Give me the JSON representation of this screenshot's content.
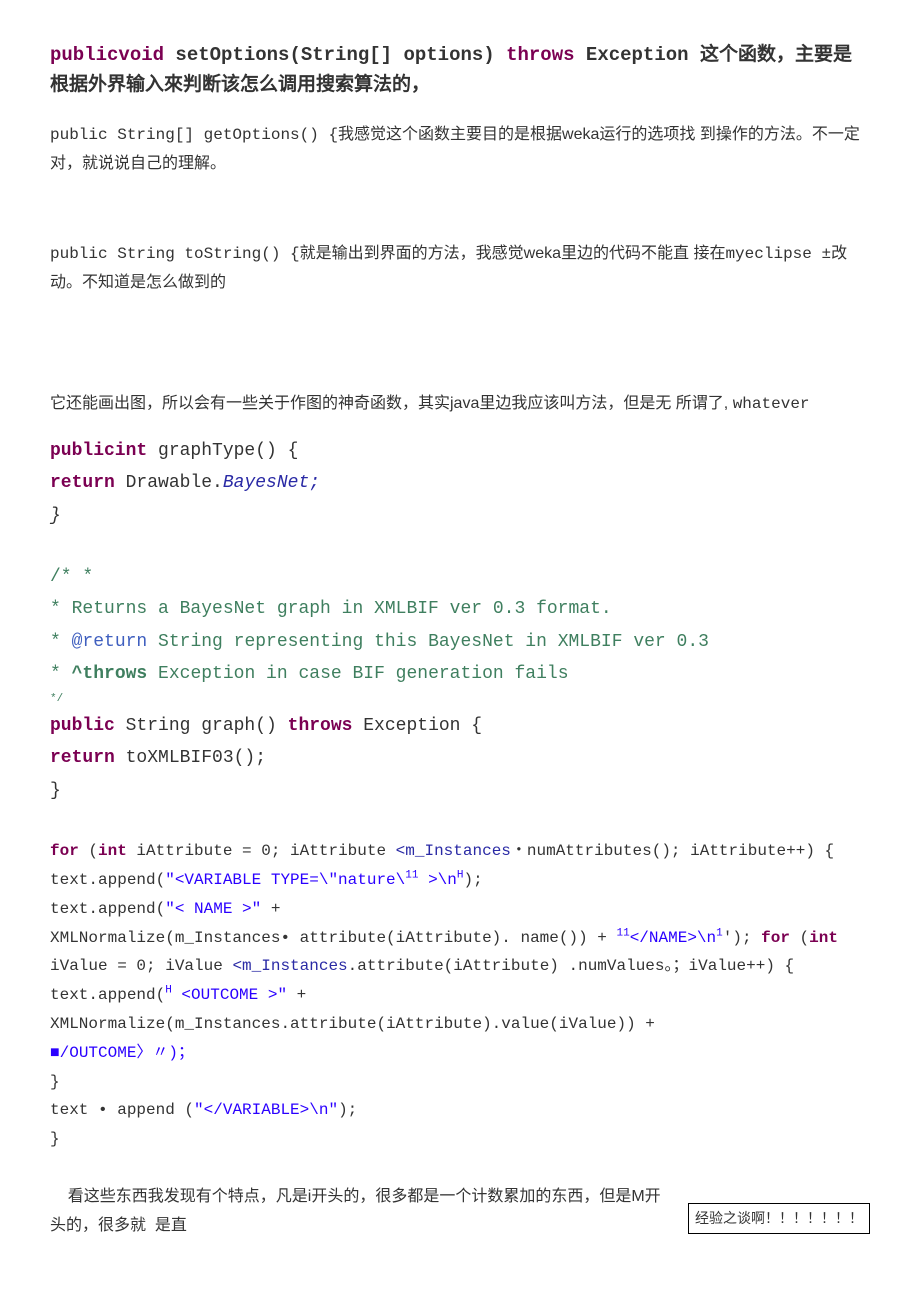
{
  "heading": {
    "part1": "publicvoid",
    "part2": " setOptions(String[] options) ",
    "part3": "throws",
    "part4": " Exception ",
    "part5_cn": "这个函数，主要是根据外界输入來判断该怎么调用搜索算法的，"
  },
  "p1": {
    "code": "public String[] getOptions()  {",
    "cn": "我感觉这个函数主要目的是根据weka运行的选项找  到操作的方法。不一定对，就说说自己的理解。"
  },
  "p2": {
    "code": "   public String toString()  {",
    "cn1": "就是输出到界面的方法，我感觉weka里边的代码不能直  接在",
    "code2": "myeclipse ±",
    "cn2": "改动。不知道是怎么做到的"
  },
  "p3": {
    "cn1": "它还能画出图，所以会有一些关于作图的神奇函数，其实java里边我应该叫方法，但是无  所谓了, ",
    "code": "whatever"
  },
  "graphType": {
    "l1a": "publicint",
    "l1b": " graphType() {",
    "l2a": "return",
    "l2b": " Drawable.",
    "l2c": "BayesNet;",
    "l3": "  }"
  },
  "comment": {
    "l1": "/* *",
    "l2": "   * Returns a BayesNet graph in XMLBIF ver 0.3 format.",
    "l3a": "   * ",
    "l3b": "@return",
    "l3c": " String representing this BayesNet in XMLBIF ver 0.3",
    "l4a": "   * ",
    "l4b": "^throws",
    "l4c": " Exception in case BIF generation fails",
    "l5": "   */"
  },
  "graph": {
    "l1a": "public",
    "l1b": " String graph() ",
    "l1c": "throws",
    "l1d": " Exception {",
    "l2a": "return",
    "l2b": " toXMLBIF03();",
    "l3": "  }"
  },
  "loop": {
    "l1a": "for",
    "l1b": " (",
    "l1c": "int",
    "l1d": " iAttribute = 0; iAttribute ",
    "l1e": "<m_Instances",
    "l1f": "・numAttributes(); iAttribute++) {",
    "l2a": "      text.append(",
    "l2b": "\"<VARIABLE TYPE=\\\"nature\\",
    "l2sup": "11",
    "l2c": " >\\n",
    "l2d": "H",
    "l2e": ");",
    "l3a": "      text.append(",
    "l3b": "\"< NAME >\"",
    "l3c": " +",
    "l4a": "XMLNormalize(m_Instances• attribute(iAttribute). name()) + ",
    "l4b": "11",
    "l4c": "</NAME>\\n",
    "l4d": "1",
    "l4e": "'); ",
    "l4f": "for",
    "l4g": " (",
    "l4h": "int",
    "l4i": " iValue = 0; iValue ",
    "l4j": "<m_Instances",
    "l4k": ".attribute(iAttribute) .numValues。；iValue++) {",
    "l5a": "    text.append(",
    "l5b": "H",
    "l5c": " <OUTCOME >\"",
    "l5d": " +",
    "l6": "XMLNormalize(m_Instances.attribute(iAttribute).value(iValue)) +",
    "l7a": "■",
    "l7b": "/OUTCOME〉〃)；",
    "l8": "      }",
    "l9a": "      text • append (",
    "l9b": "\"</VARIABLE>\\n\"",
    "l9c": ");",
    "l10": "    }"
  },
  "bottom": {
    "cn1": "    看这些东西我发现有个特点，凡是i开头的，很多都是一个计数累加的东西，但是M开头的，很多就  是直",
    "box": "经验之谈啊！！！！！！！"
  }
}
